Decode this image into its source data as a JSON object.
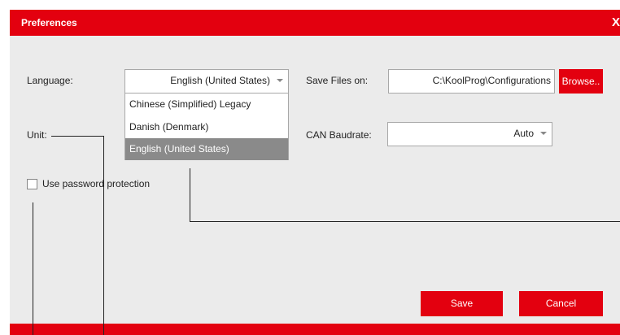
{
  "window": {
    "title": "Preferences",
    "close_label": "X"
  },
  "language": {
    "label": "Language:",
    "selected": "English (United States)",
    "options": [
      "Chinese (Simplified) Legacy",
      "Danish (Denmark)",
      "English (United States)"
    ]
  },
  "save_files": {
    "label": "Save Files on:",
    "value": "C:\\KoolProg\\Configurations",
    "browse_label": "Browse.."
  },
  "unit": {
    "label": "Unit:"
  },
  "can_baudrate": {
    "label": "CAN Baudrate:",
    "selected": "Auto"
  },
  "password": {
    "label": "Use password protection",
    "checked": false
  },
  "buttons": {
    "save": "Save",
    "cancel": "Cancel"
  },
  "colors": {
    "accent": "#e3000f",
    "background": "#ebebeb",
    "selected_option": "#8a8a8a"
  }
}
